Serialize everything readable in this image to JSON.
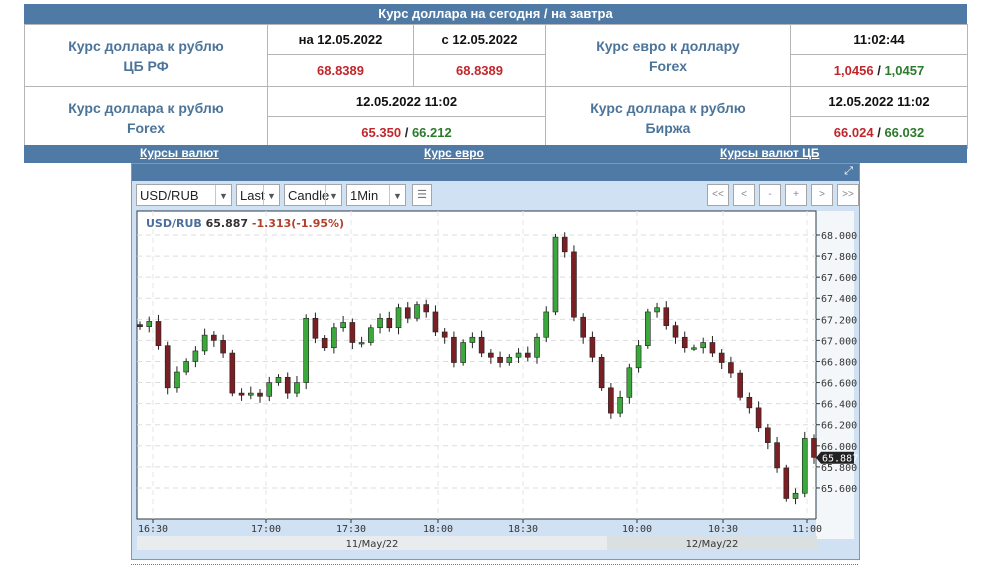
{
  "header": {
    "title": "Курс доллара на сегодня / на завтра"
  },
  "rates_table": {
    "cbr": {
      "label_line1": "Курс доллара к рублю",
      "label_line2": "ЦБ РФ",
      "col1_header": "на 12.05.2022",
      "col2_header": "с 12.05.2022",
      "col1_value": "68.8389",
      "col2_value": "68.8389"
    },
    "eur_usd": {
      "label_line1": "Курс евро к доллару",
      "label_line2": "Forex",
      "time": "11:02:44",
      "bid": "1,0456",
      "ask": "1,0457"
    },
    "usd_rub_forex": {
      "label_line1": "Курс доллара к рублю",
      "label_line2": "Forex",
      "datetime": "12.05.2022 11:02",
      "bid": "65.350",
      "ask": "66.212"
    },
    "usd_rub_exchange": {
      "label_line1": "Курс доллара к рублю",
      "label_line2": "Биржа",
      "datetime": "12.05.2022 11:02",
      "bid": "66.024",
      "ask": "66.032"
    },
    "separator": "/"
  },
  "nav_links": [
    "Курсы валют",
    "Курс евро",
    "Курсы валют ЦБ"
  ],
  "toolbar": {
    "symbol": "USD/RUB",
    "price_type": "Last",
    "chart_type": "Candle",
    "interval": "1Min",
    "nav_buttons": [
      "<<",
      "<",
      "-",
      "+",
      ">",
      ">>"
    ],
    "dropdown_glyph": "▼",
    "grid_glyph": "☰",
    "expand_glyph": "⤢"
  },
  "chart_data": {
    "type": "candlestick",
    "title": "USD/RUB",
    "last_price": "65.887",
    "change": "-1.313(-1.95%)",
    "last_price_marker": "65.887",
    "ylim": [
      65.45,
      68.15
    ],
    "yticks": [
      "68.000",
      "67.800",
      "67.600",
      "67.400",
      "67.200",
      "67.000",
      "66.800",
      "66.600",
      "66.400",
      "66.200",
      "66.000",
      "65.800",
      "65.600"
    ],
    "ytick_values": [
      68.0,
      67.8,
      67.6,
      67.4,
      67.2,
      67.0,
      66.8,
      66.6,
      66.4,
      66.2,
      66.0,
      65.8,
      65.6
    ],
    "xticks": [
      "16:30",
      "17:00",
      "17:30",
      "18:00",
      "18:30",
      "10:00",
      "10:30",
      "11:00"
    ],
    "date_labels": [
      "11/May/22",
      "12/May/22"
    ],
    "grid": true,
    "colors": {
      "up": "#3aa83a",
      "down": "#7a1f24",
      "wick": "#222222"
    },
    "close_path": [
      67.13,
      67.18,
      66.95,
      66.55,
      66.7,
      66.8,
      66.9,
      67.05,
      67.0,
      66.88,
      66.5,
      66.48,
      66.5,
      66.47,
      66.6,
      66.65,
      66.5,
      66.6,
      67.21,
      67.02,
      66.93,
      67.12,
      67.17,
      66.98,
      66.98,
      67.12,
      67.21,
      67.12,
      67.31,
      67.21,
      67.34,
      67.27,
      67.08,
      67.03,
      66.79,
      66.98,
      67.03,
      66.88,
      66.84,
      66.79,
      66.84,
      66.88,
      66.84,
      67.03,
      67.27,
      67.98,
      67.84,
      67.22,
      67.03,
      66.84,
      66.55,
      66.31,
      66.46,
      66.74,
      66.95,
      67.27,
      67.31,
      67.14,
      67.03,
      66.93,
      66.93,
      66.98,
      66.88,
      66.79,
      66.69,
      66.46,
      66.36,
      66.17,
      66.03,
      65.79,
      65.5,
      65.55,
      66.07,
      65.89
    ]
  }
}
